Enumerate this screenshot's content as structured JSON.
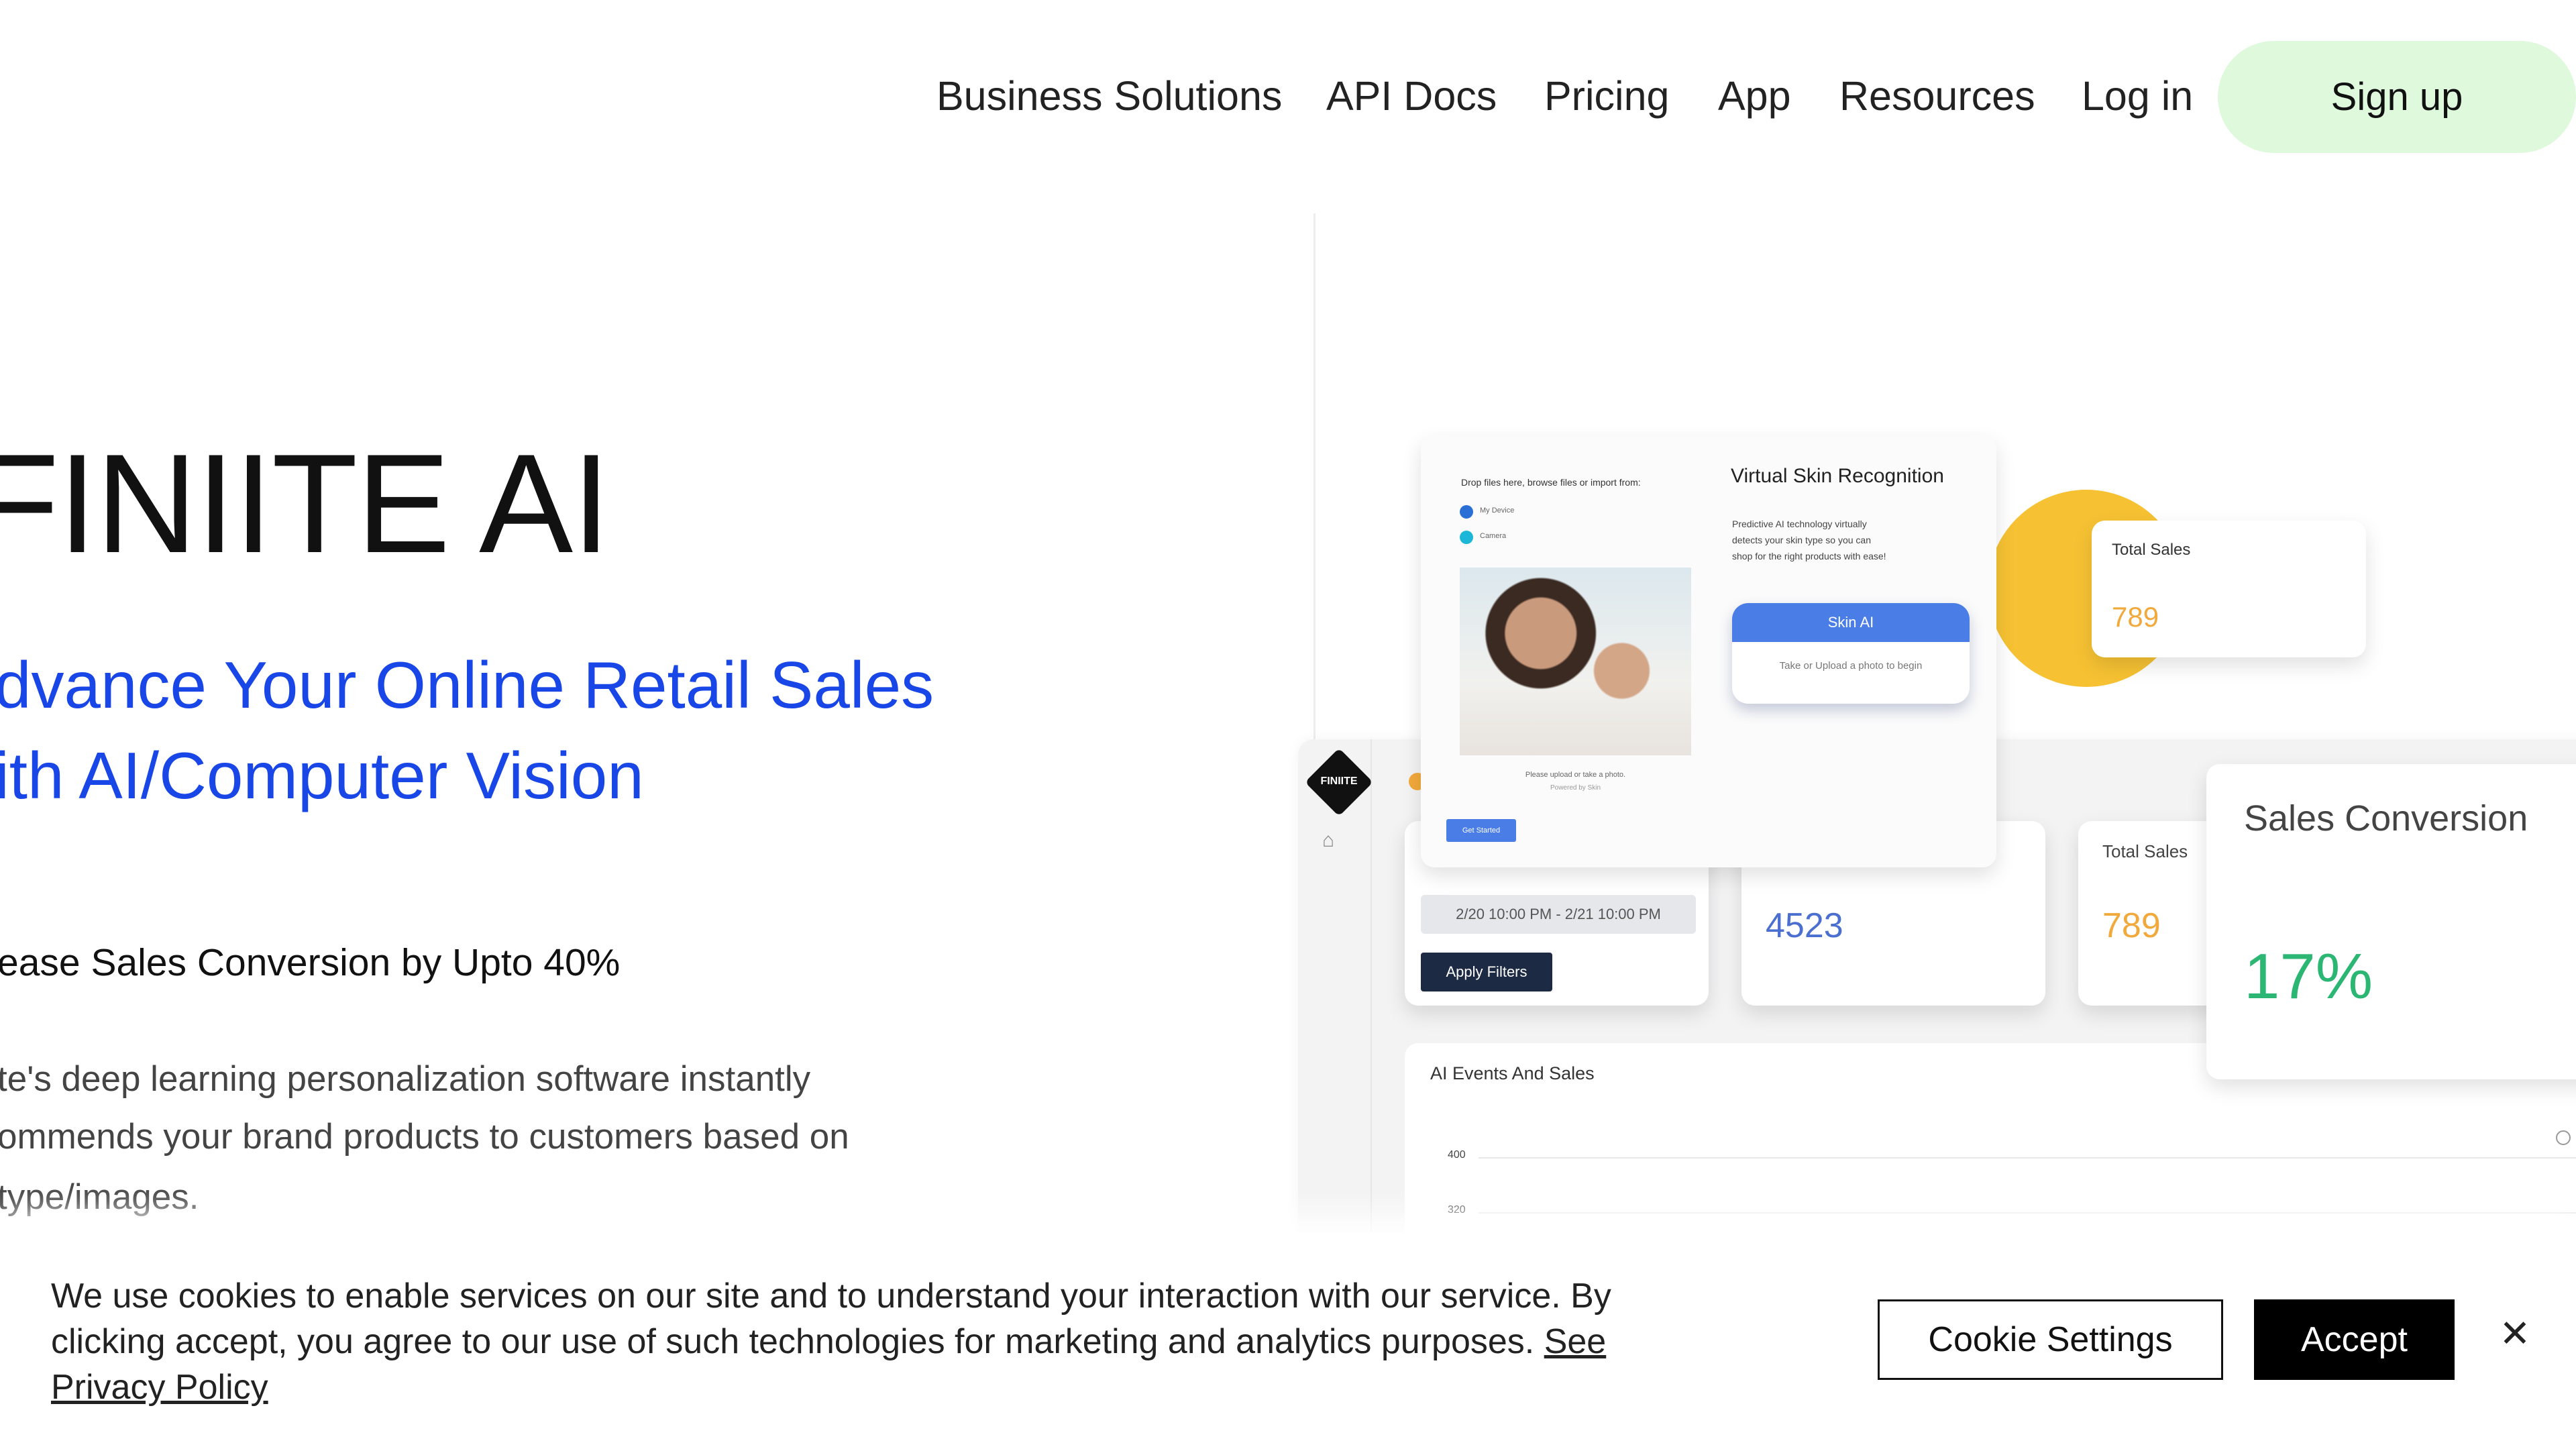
{
  "nav": {
    "items": [
      "Business Solutions",
      "API Docs",
      "Pricing",
      "App",
      "Resources",
      "Log in"
    ],
    "signup": "Sign up"
  },
  "hero": {
    "title": "FINIITE AI",
    "headline": [
      "dvance Your Online Retail Sales",
      "ith AI/Computer Vision"
    ],
    "subheading": "ease Sales Conversion by Upto 40%",
    "paragraph": [
      "te's deep learning personalization software instantly",
      "ommends your brand products to customers based on",
      " type/images."
    ]
  },
  "mockup": {
    "logo": "FINIITE",
    "skin_card": {
      "drop_text": "Drop files here, browse files or import from:",
      "sources": [
        "My Device",
        "Camera"
      ],
      "photo_caption": [
        "Please upload or take a photo.",
        "Powered by Skin"
      ],
      "get_started": "Get Started",
      "title": "Virtual Skin Recognition",
      "description": "Predictive AI technology virtually detects your skin type so you can shop for the right products with ease!",
      "skin_ai_button": "Skin AI",
      "skin_ai_hint": "Take or Upload a photo to begin"
    },
    "total_sales_float": {
      "label": "Total Sales",
      "value": "789"
    },
    "filters": {
      "date_range": "2/20 10:00 PM - 2/21 10:00 PM",
      "apply": "Apply Filters"
    },
    "events_value": "4523",
    "total_sales": {
      "label": "Total Sales",
      "value": "789"
    },
    "sales_conversion": {
      "label": "Sales Conversion",
      "value": "17%"
    },
    "chart": {
      "title": "AI Events And Sales",
      "ticks": [
        "400",
        "320"
      ]
    },
    "colors": {
      "blue": "#4a7de6",
      "orange": "#f2a93b",
      "green": "#2bb673",
      "yellow": "#f6c233"
    }
  },
  "cookie": {
    "text": [
      "We use cookies to enable services on our site and to understand your interaction with our service. By",
      "clicking accept, you agree to our use of such technologies for marketing and analytics purposes. "
    ],
    "link_a": "See",
    "link_b": "Privacy Policy",
    "settings": "Cookie Settings",
    "accept": "Accept",
    "close": "✕"
  }
}
